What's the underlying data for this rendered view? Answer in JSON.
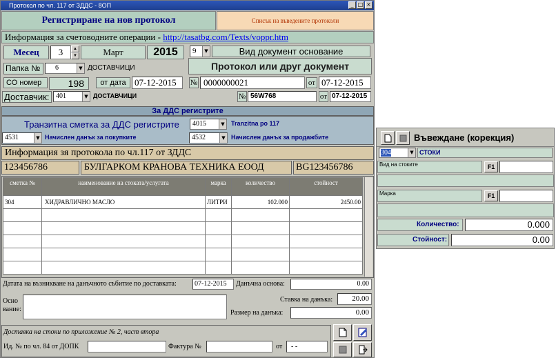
{
  "window": {
    "title": "Протокол по чл. 117 от ЗДДС - 8ОП",
    "tabs": {
      "active": "Регистриране на нов протокол",
      "other": "Списък на въведените протоколи"
    }
  },
  "info_line": {
    "text": "Информация за счетоводните операции - ",
    "link": "http://tasatbg.com/Texts/voppr.htm"
  },
  "period": {
    "month_label": "Месец",
    "month_num": "3",
    "month_name": "Март",
    "year": "2015"
  },
  "doc_type": {
    "code": "9",
    "label": "Вид документ основание",
    "value": "Протокол или друг документ"
  },
  "folder": {
    "label": "Папка №",
    "num": "6",
    "name": "ДОСТАВЧИЦИ"
  },
  "so": {
    "label": "СО номер",
    "num": "198",
    "date_label": "от дата",
    "date": "07-12-2015",
    "doc_no_label": "№",
    "doc_no": "0000000021",
    "doc_date_label": "от",
    "doc_date": "07-12-2015"
  },
  "supplier": {
    "label": "Доставчик:",
    "code": "401",
    "name": "ДОСТАВЧИЦИ",
    "no_label": "№",
    "no": "56W768",
    "date_label": "от",
    "date": "07-12-2015"
  },
  "vat_registers": {
    "heading": "За ДДС регистрите",
    "transit_label": "Транзитна сметка за ДДС регистрите",
    "transit_code": "4015",
    "transit_name": "Tranzitna po 117",
    "purchase_code": "4531",
    "purchase_label": "Начислен данък за покупките",
    "sales_code": "4532",
    "sales_label": "Начислен данък за продажбите"
  },
  "protocol_info": {
    "heading": "Информация зя протокола по чл.117 от ЗДДС",
    "id": "123456786",
    "company": "БУЛГАРКОМ КРАНОВА ТЕХНИКА  ЕООД",
    "vat_no": "BG123456786"
  },
  "table": {
    "headers": [
      "сметка №",
      "наименование на стоката/услугата",
      "марка",
      "количество",
      "стойност"
    ],
    "rows": [
      [
        "304",
        "ХИДРАВЛИЧНО МАСЛО",
        "ЛИТРИ",
        "102.000",
        "2450.00"
      ],
      [
        "",
        "",
        "",
        "",
        ""
      ],
      [
        "",
        "",
        "",
        "",
        ""
      ],
      [
        "",
        "",
        "",
        "",
        ""
      ],
      [
        "",
        "",
        "",
        "",
        ""
      ],
      [
        "",
        "",
        "",
        "",
        ""
      ]
    ]
  },
  "footer": {
    "event_date_label": "Датата на възникване на данъчното събитие по доставката:",
    "event_date": "07-12-2015",
    "tax_base_label": "Данъчна основа:",
    "tax_base": "0.00",
    "basis_label": "Осно вание:",
    "rate_label": "Ставка на данъка:",
    "rate": "20.00",
    "tax_amount_label": "Размер на данъка:",
    "tax_amount": "0.00",
    "delivery_heading": "Доставка на стоки по приложение № 2, част втора",
    "id_label": "Ид. № по чл. 84 от ДОПК",
    "invoice_label": "Фактура №",
    "from_label": "от",
    "from_value": "- -"
  },
  "entry_panel": {
    "title": "Въвеждане (корекция)",
    "account_code": "304",
    "account_name": "СТОКИ",
    "goods_type_label": "Вид на стоките",
    "brand_label": "Марка",
    "f1": "F1",
    "quantity_label": "Количество:",
    "quantity": "0.000",
    "value_label": "Стойност:",
    "value": "0.00"
  }
}
